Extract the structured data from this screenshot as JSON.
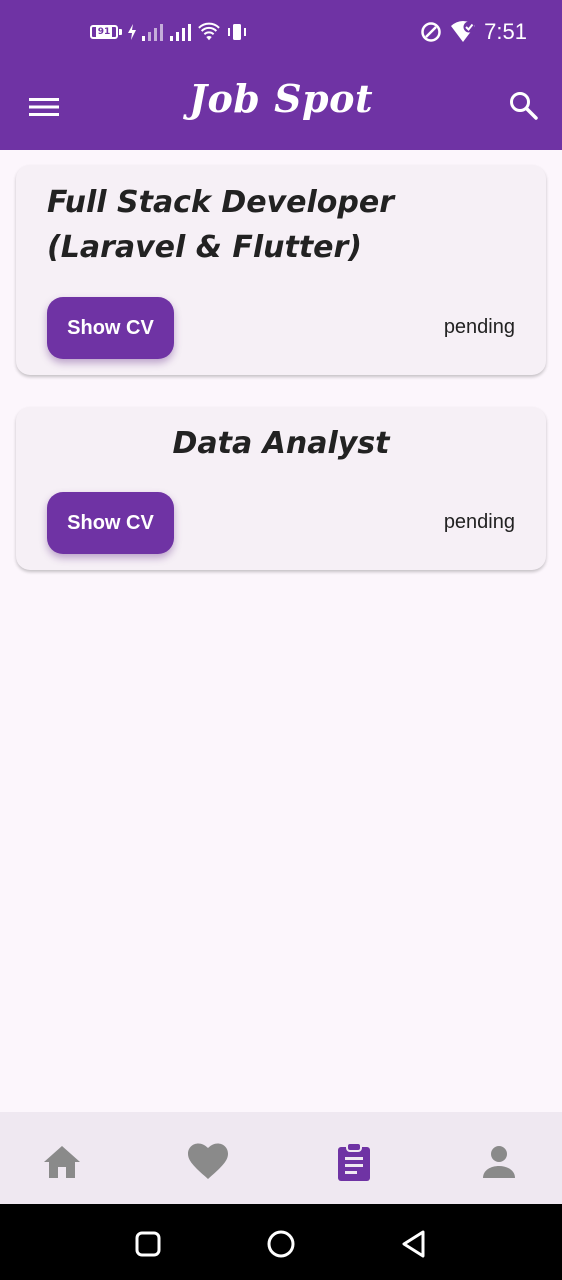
{
  "status_bar": {
    "battery_level": "91",
    "time": "7:51"
  },
  "app_bar": {
    "title": "Job Spot",
    "menu_icon": "menu-icon",
    "search_icon": "search-icon"
  },
  "applications": [
    {
      "title": "Full Stack Developer (Laravel & Flutter)",
      "button_label": "Show CV",
      "status": "pending"
    },
    {
      "title": "Data Analyst",
      "button_label": "Show CV",
      "status": "pending"
    }
  ],
  "bottom_nav": {
    "items": [
      {
        "icon": "home-icon",
        "active": false
      },
      {
        "icon": "heart-icon",
        "active": false
      },
      {
        "icon": "clipboard-icon",
        "active": true
      },
      {
        "icon": "person-icon",
        "active": false
      }
    ]
  },
  "colors": {
    "primary": "#6f33a4",
    "background": "#fcf6fc",
    "card": "#f6f0f6",
    "nav_inactive": "#8a8a8a",
    "bottom_nav_bg": "#efe8f1"
  }
}
